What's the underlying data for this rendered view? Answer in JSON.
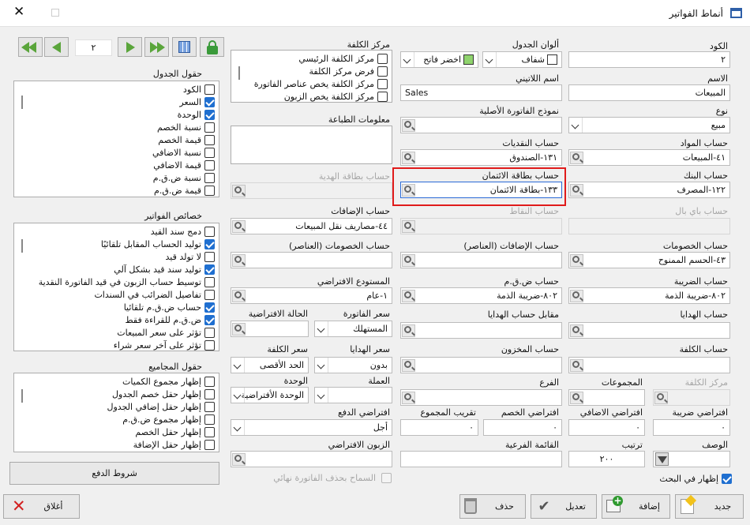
{
  "window": {
    "title": "أنماط الفواتير"
  },
  "labels": {
    "code": "الكود",
    "name": "الاسم",
    "type": "نوع",
    "materials_account": "حساب المواد",
    "bank_account": "حساب البنك",
    "paypal_account": "حساب باي بال",
    "discounts_account": "حساب الخصومات",
    "tax_account": "حساب الضريبة",
    "gifts_account": "حساب الهدايا",
    "cost_account": "حساب الكلفة",
    "cost_center": "مركز الكلفة",
    "groups": "المجموعات",
    "tax_default": "افتراضي ضريبة",
    "additions_default": "افتراضي الاضافي",
    "discount_default": "افتراضي الخصم",
    "rounding_total": "تقريب المجموع",
    "description": "الوصف",
    "order": "ترتيب",
    "branch_list": "القائمة الفرعية",
    "default_customer": "الزبون الافتراضي",
    "table_colors": "ألوان الجدول",
    "latin_name": "اسم اللاتيني",
    "original_invoice_model": "نموذج الفاتورة الأصلية",
    "cash_account": "حساب النقديات",
    "credit_card_account": "حساب بطاقة الائتمان",
    "points_account": "حساب النقاط",
    "additions_items_account": "حساب الإضافات (العناصر)",
    "vat_account": "حساب ض.ق.م",
    "gifts_counter_account": "مقابل حساب الهدايا",
    "stock_account": "حساب المخزون",
    "branch": "الفرع",
    "cost_center_section": "مركز الكلفة",
    "print_info": "معلومات الطباعة",
    "gift_card_account": "حساب بطاقة الهدية",
    "additions_account": "حساب الإضافات",
    "discounts_items_account": "حساب الخصومات (العناصر)",
    "default_warehouse": "المستودع الافتراضي",
    "invoice_price": "سعر الفاتورة",
    "default_state": "الحالة الافتراضية",
    "gifts_price": "سعر الهدايا",
    "cost_price": "سعر الكلفة",
    "currency": "العملة",
    "unit": "الوحدة",
    "payment_default": "افتراضي الدفع",
    "allow_final_delete": "السماح بحذف الفاتورة نهائي",
    "show_in_search": "إظهار في البحث",
    "table_fields": "حقول الجدول",
    "invoice_features": "خصائص الفواتير",
    "total_fields": "حقول المجاميع"
  },
  "values": {
    "code": "٢",
    "name": "المبيعات",
    "type": "مبيع",
    "materials_account": "٤١-المبيعات",
    "bank_account": "١٢٢-المصرف",
    "discounts_account": "٤٣-الحسم الممنوح",
    "tax_account": "٨٠٢-ضريبة الذمة",
    "order": "٢٠٠",
    "latin_name": "Sales",
    "cash_account": "١٣١-الصندوق",
    "credit_card_account": "١٣٣-بطاقة الائتمان",
    "vat_account": "٨٠٢-ضريبة الذمة",
    "additions_account": "٤٤-مصاريف نقل المبيعات",
    "default_warehouse": "١-عام",
    "invoice_price": "المستهلك",
    "gifts_price": "بدون",
    "cost_price": "الحد الأقصى",
    "unit": "الوحدة الأفتراضية",
    "payment_default": "أجل",
    "tax_default": "٠",
    "additions_default": "٠",
    "discount_default": "٠",
    "rounding_total": "٠",
    "color_transparent": "شفاف",
    "color_light_green": "اخضر فاتح",
    "page_number": "٢"
  },
  "cost_center_items": [
    "مركز الكلفة الرئيسي",
    "فرض مركز الكلفة",
    "مركز الكلفة يخص عناصر الفاتورة",
    "مركز الكلفة يخص الزبون"
  ],
  "table_fields": [
    {
      "label": "الكود",
      "checked": false
    },
    {
      "label": "السعر",
      "checked": true
    },
    {
      "label": "الوحدة",
      "checked": true
    },
    {
      "label": "نسبة الخصم",
      "checked": false
    },
    {
      "label": "قيمة الخصم",
      "checked": false
    },
    {
      "label": "نسبة الاضافي",
      "checked": false
    },
    {
      "label": "قيمة الاضافي",
      "checked": false
    },
    {
      "label": "نسبة ض.ق.م",
      "checked": false
    },
    {
      "label": "قيمة ض.ق.م",
      "checked": false
    }
  ],
  "invoice_features": [
    {
      "label": "دمج سند القيد",
      "checked": false
    },
    {
      "label": "توليد الحساب المقابل تلقائيًا",
      "checked": true
    },
    {
      "label": "لا تولد قيد",
      "checked": false
    },
    {
      "label": "توليد سند قيد بشكل آلي",
      "checked": true
    },
    {
      "label": "توسيط حساب الزبون في قيد الفاتورة النقدية",
      "checked": false
    },
    {
      "label": "تفاصيل الضرائب في السندات",
      "checked": false
    },
    {
      "label": "حساب ض.ق.م تلقائيا",
      "checked": true
    },
    {
      "label": "ض.ق.م للقراءة فقط",
      "checked": true
    },
    {
      "label": "تؤثر على سعر المبيعات",
      "checked": false
    },
    {
      "label": "تؤثر على آخر سعر شراء",
      "checked": false
    }
  ],
  "total_fields": [
    {
      "label": "إظهار مجموع الكميات",
      "checked": false
    },
    {
      "label": "إظهار حقل خصم الجدول",
      "checked": false
    },
    {
      "label": "إظهار حقل إضافي الجدول",
      "checked": false
    },
    {
      "label": "إظهار مجموع ض.ق.م",
      "checked": false
    },
    {
      "label": "إظهار حقل الخصم",
      "checked": false
    },
    {
      "label": "إظهار حقل الإضافة",
      "checked": false
    }
  ],
  "buttons": {
    "new": "جديد",
    "add": "إضافة",
    "edit": "تعديل",
    "delete": "حذف",
    "close": "أغلاق",
    "payment_terms": "شروط الدفع"
  },
  "colors": {
    "light_green": "#8fd36d",
    "highlight": "#e01b1b",
    "checked": "#1f6fd0",
    "nav_green": "#5aa53b"
  }
}
